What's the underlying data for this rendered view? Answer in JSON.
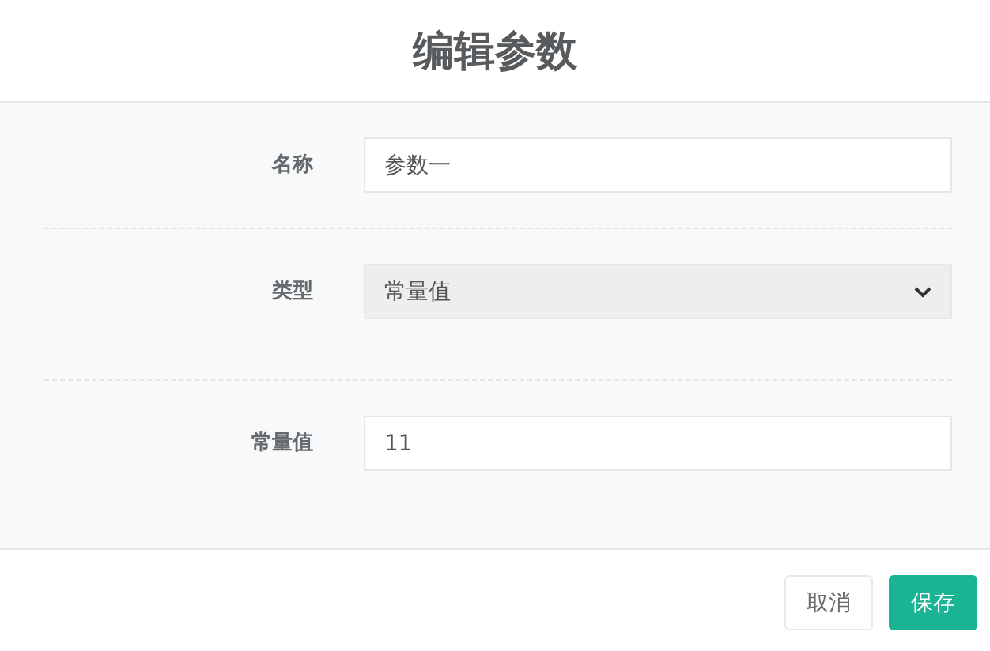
{
  "title": "编辑参数",
  "fields": [
    {
      "kind": "text",
      "label": "名称",
      "value": "参数一",
      "disabled": false
    },
    {
      "kind": "select",
      "label": "类型",
      "value": "常量值",
      "disabled": true
    },
    {
      "kind": "text",
      "label": "常量值",
      "value": "11",
      "disabled": false
    }
  ],
  "buttons": [
    {
      "kind": "default",
      "label": "取消"
    },
    {
      "kind": "primary",
      "label": "保存"
    }
  ]
}
